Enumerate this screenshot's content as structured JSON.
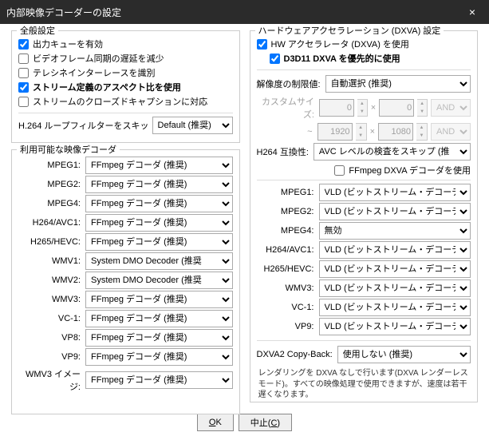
{
  "title": "内部映像デコーダーの設定",
  "left": {
    "general": {
      "legend": "全般設定",
      "opt1": "出力キューを有効",
      "opt2": "ビデオフレーム同期の遅延を減少",
      "opt3": "テレシネインターレースを識別",
      "opt4": "ストリーム定義のアスペクト比を使用",
      "opt5": "ストリームのクローズドキャプションに対応",
      "h264label": "H.264 ループフィルターをスキッ",
      "h264sel": "Default (推奨)"
    },
    "decoders": {
      "legend": "利用可能な映像デコーダ",
      "items": [
        {
          "k": "MPEG1:",
          "v": "FFmpeg デコーダ (推奨)"
        },
        {
          "k": "MPEG2:",
          "v": "FFmpeg デコーダ (推奨)"
        },
        {
          "k": "MPEG4:",
          "v": "FFmpeg デコーダ (推奨)"
        },
        {
          "k": "H264/AVC1:",
          "v": "FFmpeg デコーダ (推奨)"
        },
        {
          "k": "H265/HEVC:",
          "v": "FFmpeg デコーダ (推奨)"
        },
        {
          "k": "WMV1:",
          "v": "System DMO Decoder (推奨"
        },
        {
          "k": "WMV2:",
          "v": "System DMO Decoder (推奨"
        },
        {
          "k": "WMV3:",
          "v": "FFmpeg デコーダ (推奨)"
        },
        {
          "k": "VC-1:",
          "v": "FFmpeg デコーダ (推奨)"
        },
        {
          "k": "VP8:",
          "v": "FFmpeg デコーダ (推奨)"
        },
        {
          "k": "VP9:",
          "v": "FFmpeg デコーダ (推奨)"
        },
        {
          "k": "WMV3 イメージ:",
          "v": "FFmpeg デコーダ (推奨)"
        }
      ]
    }
  },
  "right": {
    "hw": {
      "legend": "ハードウェアアクセラレーション (DXVA) 設定",
      "useHw": "HW アクセラレータ (DXVA) を使用",
      "d3d11": "D3D11 DXVA を優先的に使用",
      "resLimit": "解像度の制限値:",
      "resSel": "自動選択 (推奨)",
      "customSize": "カスタムサイズ:",
      "w1": "0",
      "h1": "0",
      "and": "AND",
      "tilde": "~",
      "w2": "1920",
      "h2": "1080",
      "h264compat": "H264 互換性:",
      "h264compatSel": "AVC レベルの検査をスキップ (推",
      "ffdxva": "FFmpeg DXVA デコーダを使用",
      "codecs": [
        {
          "k": "MPEG1:",
          "v": "VLD (ビットストリーム・デコーディ"
        },
        {
          "k": "MPEG2:",
          "v": "VLD (ビットストリーム・デコーディ"
        },
        {
          "k": "MPEG4:",
          "v": "無効"
        },
        {
          "k": "H264/AVC1:",
          "v": "VLD (ビットストリーム・デコーディ"
        },
        {
          "k": "H265/HEVC:",
          "v": "VLD (ビットストリーム・デコーディ"
        },
        {
          "k": "WMV3:",
          "v": "VLD (ビットストリーム・デコーディ"
        },
        {
          "k": "VC-1:",
          "v": "VLD (ビットストリーム・デコーディ"
        },
        {
          "k": "VP9:",
          "v": "VLD (ビットストリーム・デコーディ"
        }
      ],
      "copyback": "DXVA2 Copy-Back:",
      "copybackSel": "使用しない (推奨)",
      "note": "レンダリングを DXVA なしで行います(DXVA レンダーレスモード)。すべての映像処理で使用できますが、速度は若干遅くなります。"
    }
  },
  "footer": {
    "ok": "OK",
    "cancel": "中止(C)"
  },
  "x": "×"
}
